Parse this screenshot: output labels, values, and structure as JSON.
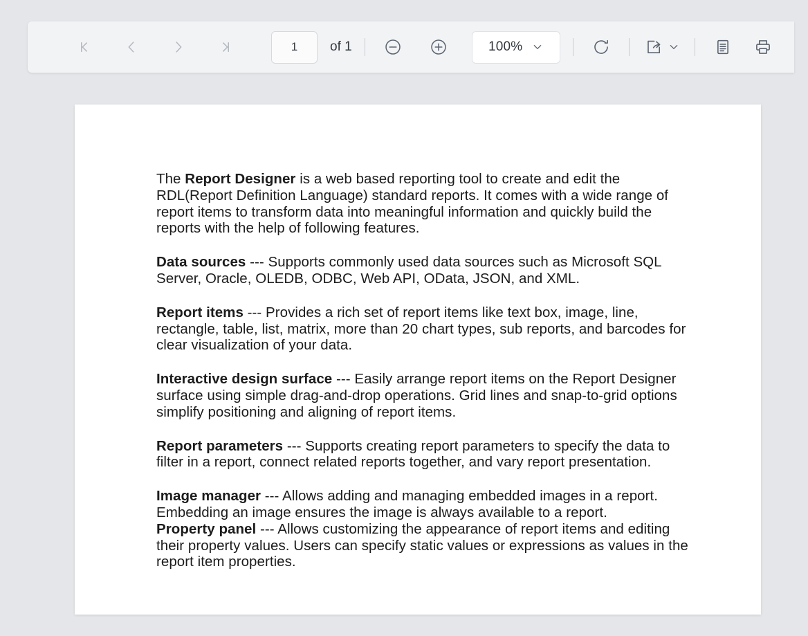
{
  "app": {
    "background_color": "#e4e6e9",
    "toolbar_color": "#f2f3f5",
    "page_color": "#ffffff"
  },
  "toolbar": {
    "first_page_label": "First page",
    "previous_page_label": "Previous page",
    "next_page_label": "Next page",
    "last_page_label": "Last page",
    "page_number_value": "1",
    "page_number_placeholder": "1",
    "page_count_label": "of 1",
    "zoom_out_label": "Zoom out",
    "zoom_in_label": "Zoom in",
    "zoom_value": "100%",
    "zoom_options": [
      "100%"
    ],
    "refresh_label": "Refresh",
    "export_label": "Export",
    "page_setup_label": "Page setup",
    "print_label": "Print",
    "icon_color": "#5b6470",
    "disabled_icon_color": "#b5b9bf"
  },
  "document": {
    "paragraphs": [
      {
        "id": "intro",
        "spans": [
          {
            "text": "The ",
            "bold": false
          },
          {
            "text": "Report Designer",
            "bold": true
          },
          {
            "text": " is a web based reporting tool to create and edit the RDL(Report Definition Language) standard reports. It comes with a wide range of report items to transform data into meaningful information and quickly build the reports with the help of following features.",
            "bold": false
          }
        ]
      },
      {
        "id": "data-sources",
        "spans": [
          {
            "text": "Data sources",
            "bold": true
          },
          {
            "text": " --- Supports commonly used data sources such as Microsoft SQL Server, Oracle, OLEDB, ODBC, Web API, OData, JSON, and XML.",
            "bold": false
          }
        ]
      },
      {
        "id": "report-items",
        "spans": [
          {
            "text": "Report items",
            "bold": true
          },
          {
            "text": " --- Provides a rich set of report items like text box, image, line, rectangle, table, list, matrix, more than 20 chart types, sub reports, and barcodes for clear visualization of your data.",
            "bold": false
          }
        ]
      },
      {
        "id": "interactive-design-surface",
        "spans": [
          {
            "text": "Interactive design surface",
            "bold": true
          },
          {
            "text": " --- Easily arrange report items on the Report Designer surface using simple drag-and-drop operations. Grid lines and snap-to-grid options simplify positioning and aligning of report items.",
            "bold": false
          }
        ]
      },
      {
        "id": "report-parameters",
        "spans": [
          {
            "text": "Report parameters",
            "bold": true
          },
          {
            "text": " --- Supports creating report parameters to specify the data to filter in a report, connect related reports together, and vary report presentation.",
            "bold": false
          }
        ]
      },
      {
        "id": "image-manager",
        "tight": true,
        "spans": [
          {
            "text": "Image manager",
            "bold": true
          },
          {
            "text": " --- Allows adding and managing embedded images in a report. Embedding an image ensures the image is always available to a report.",
            "bold": false
          }
        ]
      },
      {
        "id": "property-panel",
        "spans": [
          {
            "text": "Property panel",
            "bold": true
          },
          {
            "text": " --- Allows customizing the appearance of report items and editing their property values. Users can specify static values or expressions as values in the report item properties.",
            "bold": false
          }
        ]
      }
    ]
  }
}
